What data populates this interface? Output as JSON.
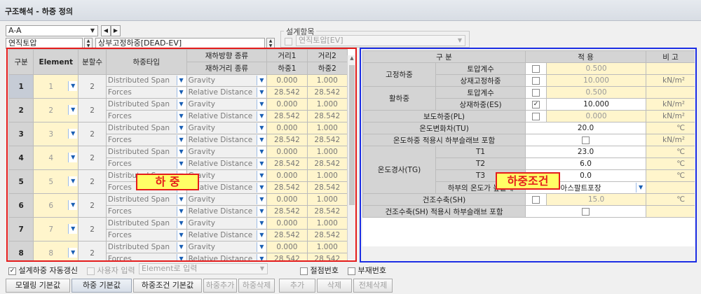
{
  "title": "구조해석 - 하중 정의",
  "selectors": {
    "member": "A-A",
    "component": "연직토압",
    "load_case": "상부고정하중[DEAD-EV]",
    "design_item_label": "설계항목",
    "design_item_value": "연직토압[EV]"
  },
  "load_grid": {
    "headers": {
      "no": "구분",
      "element": "Element",
      "split": "분할수",
      "load_type": "하중타입",
      "dir_top": "재하방향 종류",
      "dir_bottom": "재하거리 종류",
      "d1_top": "거리1",
      "d1_bottom": "하중1",
      "d2_top": "거리2",
      "d2_bottom": "하중2"
    },
    "rows": [
      {
        "no": "1",
        "element": "1",
        "split": "2",
        "type_a": "Distributed Span",
        "type_b": "Forces",
        "dir_a": "Gravity",
        "dir_b": "Relative Distance",
        "d1": "0.000",
        "d2": "1.000",
        "l1": "28.542",
        "l2": "28.542"
      },
      {
        "no": "2",
        "element": "2",
        "split": "2",
        "type_a": "Distributed Span",
        "type_b": "Forces",
        "dir_a": "Gravity",
        "dir_b": "Relative Distance",
        "d1": "0.000",
        "d2": "1.000",
        "l1": "28.542",
        "l2": "28.542"
      },
      {
        "no": "3",
        "element": "3",
        "split": "2",
        "type_a": "Distributed Span",
        "type_b": "Forces",
        "dir_a": "Gravity",
        "dir_b": "Relative Distance",
        "d1": "0.000",
        "d2": "1.000",
        "l1": "28.542",
        "l2": "28.542"
      },
      {
        "no": "4",
        "element": "4",
        "split": "2",
        "type_a": "Distributed Span",
        "type_b": "Forces",
        "dir_a": "Gravity",
        "dir_b": "Relative Distance",
        "d1": "0.000",
        "d2": "1.000",
        "l1": "28.542",
        "l2": "28.542"
      },
      {
        "no": "5",
        "element": "5",
        "split": "2",
        "type_a": "Distributed Span",
        "type_b": "Forces",
        "dir_a": "Gravity",
        "dir_b": "Relative Distance",
        "d1": "0.000",
        "d2": "1.000",
        "l1": "28.542",
        "l2": "28.542"
      },
      {
        "no": "6",
        "element": "6",
        "split": "2",
        "type_a": "Distributed Span",
        "type_b": "Forces",
        "dir_a": "Gravity",
        "dir_b": "Relative Distance",
        "d1": "0.000",
        "d2": "1.000",
        "l1": "28.542",
        "l2": "28.542"
      },
      {
        "no": "7",
        "element": "7",
        "split": "2",
        "type_a": "Distributed Span",
        "type_b": "Forces",
        "dir_a": "Gravity",
        "dir_b": "Relative Distance",
        "d1": "0.000",
        "d2": "1.000",
        "l1": "28.542",
        "l2": "28.542"
      },
      {
        "no": "8",
        "element": "8",
        "split": "2",
        "type_a": "Distributed Span",
        "type_b": "Forces",
        "dir_a": "Gravity",
        "dir_b": "Relative Distance",
        "d1": "0.000",
        "d2": "1.000",
        "l1": "28.542",
        "l2": "28.542"
      }
    ],
    "overlay_label": "하  중"
  },
  "cond_grid": {
    "headers": {
      "category": "구 분",
      "apply": "적 용",
      "note": "비 고"
    },
    "fixed_load": "고정하중",
    "soil_coeff": "토압계수",
    "superimposed": "상재고정하중",
    "live_load": "활하중",
    "live_superimposed": "상재하중(ES)",
    "sidewalk": "보도하중(PL)",
    "temp_change": "온도변화차(TU)",
    "temp_slab": "온도하중 적용시 하부슬래브 포함",
    "temp_grad": "온도경사(TG)",
    "t1": "T1",
    "t2": "T2",
    "t3": "T3",
    "lower_temp": "하부의 온도가 높을때",
    "lower_temp_value": "아스팔트포장",
    "shrink": "건조수축(SH)",
    "shrink_slab": "건조수축(SH) 적용시 하부슬래브 포함",
    "values": {
      "fixed_k": "0.500",
      "fixed_super": "10.000",
      "live_k": "0.500",
      "live_super": "10.000",
      "sidewalk": "0.000",
      "tu": "20.0",
      "t1": "23.0",
      "t2": "6.0",
      "t3": "0.0",
      "sh": "15.0"
    },
    "units": {
      "kn": "kN/m²",
      "deg": "℃"
    },
    "check_mark": "✓",
    "overlay_label": "하중조건"
  },
  "options": {
    "auto_update": "설계하중 자동갱신",
    "user_input": "사용자 입력",
    "input_mode": "Element로 입력",
    "node_no": "절점번호",
    "member_no": "부재번호"
  },
  "buttons": {
    "modeling_default": "모델링 기본값",
    "load_default": "하중 기본값",
    "cond_default": "하중조건 기본값",
    "add_load": "하중추가",
    "del_load": "하중삭제",
    "add": "추가",
    "delete": "삭제",
    "delete_all": "전체삭제"
  },
  "colors": {
    "red_frame": "#e41c1c",
    "blue_frame": "#1c2ee4",
    "yellow_cell": "#fff5cc",
    "overlay_fill": "#ffff66"
  },
  "icons": {
    "dropdown": "chevron-down-icon",
    "prev": "triangle-left-icon",
    "next": "triangle-right-icon",
    "check": "checkmark-icon"
  }
}
